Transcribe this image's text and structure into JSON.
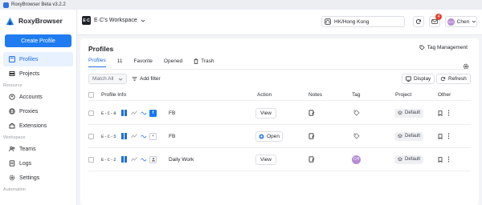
{
  "window": {
    "title": "RoxyBrowser Beta v3.2.2"
  },
  "sidebar": {
    "brand": "RoxyBrowser",
    "create_label": "Create Profile",
    "items_top": [
      {
        "label": "Profiles",
        "icon": "profiles-icon",
        "active": true
      },
      {
        "label": "Projects",
        "icon": "projects-icon",
        "active": false
      }
    ],
    "resource_section": "Resource",
    "items_resource": [
      {
        "label": "Accounts",
        "icon": "accounts-icon"
      },
      {
        "label": "Proxies",
        "icon": "proxies-icon"
      },
      {
        "label": "Extensions",
        "icon": "extensions-icon"
      }
    ],
    "workspace_section": "Workspace",
    "items_workspace": [
      {
        "label": "Teams",
        "icon": "teams-icon"
      },
      {
        "label": "Logs",
        "icon": "logs-icon"
      },
      {
        "label": "Settings",
        "icon": "settings-icon"
      }
    ],
    "automation_section": "Automation"
  },
  "topbar": {
    "workspace_badge": "E·C",
    "workspace_name": "E·C's Workspace",
    "region": "HK/Hong Kong",
    "notification_count": "4",
    "user_initials": "CH",
    "user_name": "Chen"
  },
  "main": {
    "title": "Profiles",
    "tag_management": "Tag Management",
    "tabs": [
      {
        "label": "Profiles",
        "active": true
      },
      {
        "label": "11",
        "active": false
      },
      {
        "label": "Favorite",
        "active": false
      },
      {
        "label": "Opened",
        "active": false
      },
      {
        "label": "Trash",
        "active": false
      }
    ],
    "match_all": "Match All",
    "add_filter": "Add filter",
    "display_label": "Display",
    "refresh_label": "Refresh",
    "columns": {
      "profile_info": "Profile Info",
      "action": "Action",
      "notes": "Notes",
      "tag": "Tag",
      "project": "Project",
      "other": "Other"
    },
    "rows": [
      {
        "serial": "E-C-8",
        "name": "FB",
        "action": "View",
        "tag_initials": "",
        "project": "Default"
      },
      {
        "serial": "E-C-5",
        "name": "FB",
        "action": "Open",
        "tag_initials": "",
        "project": "Default"
      },
      {
        "serial": "E-C-2",
        "name": "Daily Work",
        "action": "View",
        "tag_initials": "CH",
        "project": "Default"
      }
    ]
  },
  "colors": {
    "accent": "#1f7cf0",
    "tag_avatar": "#b58ad6",
    "badge": "#e8412b"
  }
}
